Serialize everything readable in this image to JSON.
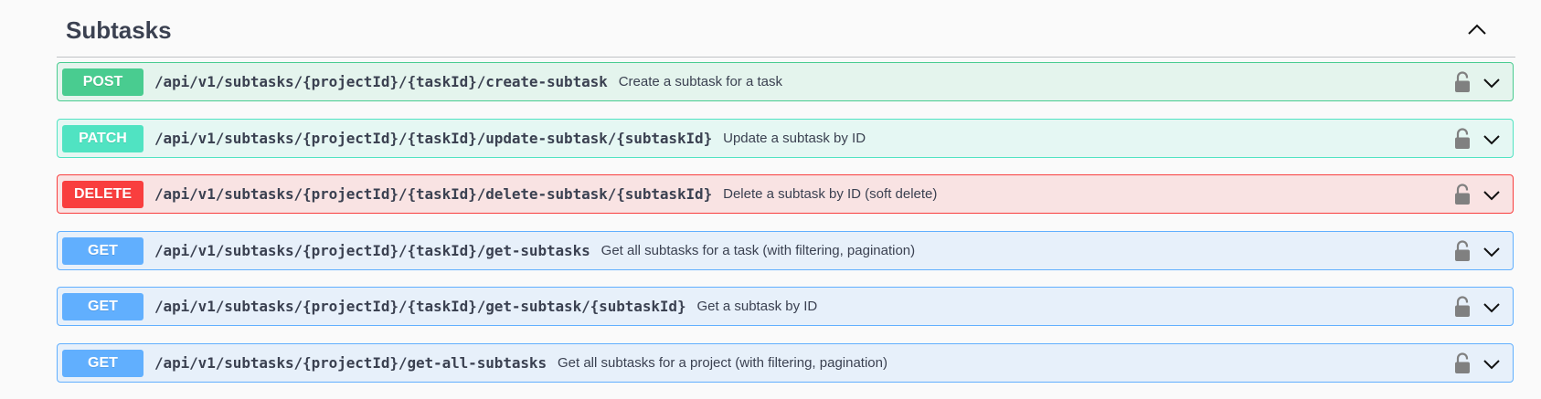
{
  "section": {
    "title": "Subtasks",
    "toggle_icon": "chevron-up-icon"
  },
  "colors": {
    "post": "#49cc90",
    "patch": "#50e3c2",
    "delete": "#f93e3e",
    "get": "#61affe"
  },
  "operations": [
    {
      "method": "POST",
      "path": "/api/v1/subtasks/{projectId}/{taskId}/create-subtask",
      "summary": "Create a subtask for a task",
      "lock_icon": "unlocked-padlock-icon",
      "expand_icon": "chevron-down-icon"
    },
    {
      "method": "PATCH",
      "path": "/api/v1/subtasks/{projectId}/{taskId}/update-subtask/{subtaskId}",
      "summary": "Update a subtask by ID",
      "lock_icon": "unlocked-padlock-icon",
      "expand_icon": "chevron-down-icon"
    },
    {
      "method": "DELETE",
      "path": "/api/v1/subtasks/{projectId}/{taskId}/delete-subtask/{subtaskId}",
      "summary": "Delete a subtask by ID (soft delete)",
      "lock_icon": "unlocked-padlock-icon",
      "expand_icon": "chevron-down-icon"
    },
    {
      "method": "GET",
      "path": "/api/v1/subtasks/{projectId}/{taskId}/get-subtasks",
      "summary": "Get all subtasks for a task (with filtering, pagination)",
      "lock_icon": "unlocked-padlock-icon",
      "expand_icon": "chevron-down-icon"
    },
    {
      "method": "GET",
      "path": "/api/v1/subtasks/{projectId}/{taskId}/get-subtask/{subtaskId}",
      "summary": "Get a subtask by ID",
      "lock_icon": "unlocked-padlock-icon",
      "expand_icon": "chevron-down-icon"
    },
    {
      "method": "GET",
      "path": "/api/v1/subtasks/{projectId}/get-all-subtasks",
      "summary": "Get all subtasks for a project (with filtering, pagination)",
      "lock_icon": "unlocked-padlock-icon",
      "expand_icon": "chevron-down-icon"
    }
  ]
}
